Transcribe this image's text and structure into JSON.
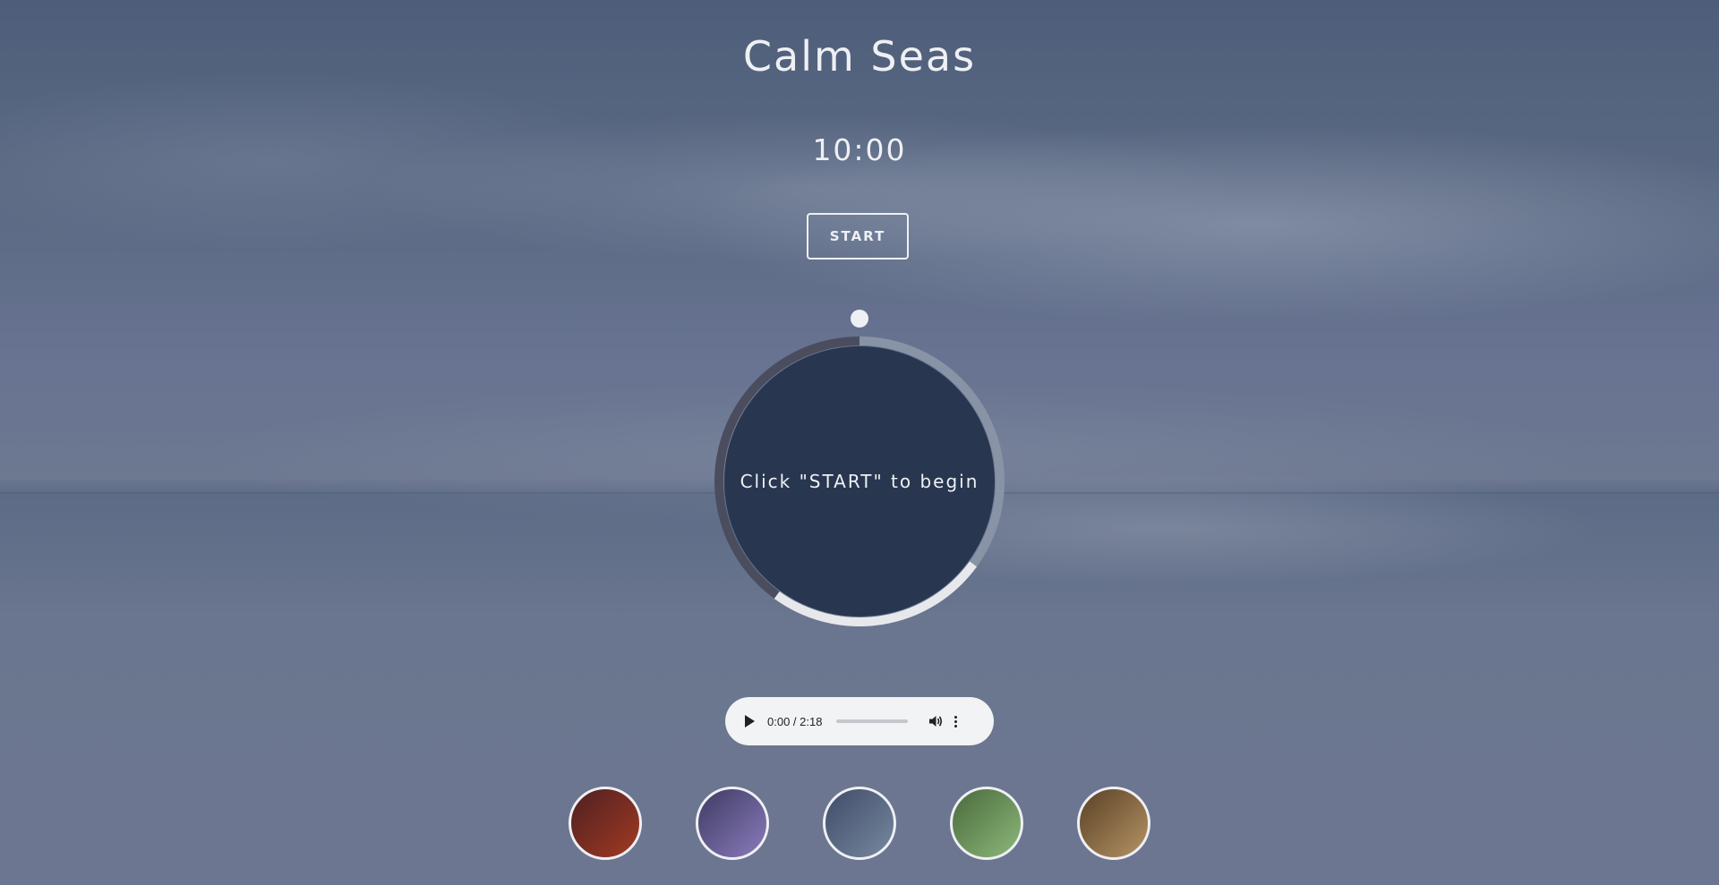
{
  "app": {
    "title": "Calm Seas"
  },
  "timer": {
    "display": "10:00",
    "start_label": "START"
  },
  "breath_circle": {
    "prompt": "Click \"START\" to begin",
    "colors": {
      "inner": "#283650",
      "track": "#8993a6",
      "dark_segment": "#4a4d5e",
      "light_segment": "#e6e8ec",
      "indicator": "#eef0f4"
    }
  },
  "audio_player": {
    "time": "0:00 / 2:18",
    "play_icon": "play-icon",
    "volume_icon": "volume-icon",
    "more_icon": "more-options-icon"
  },
  "themes": [
    {
      "name": "red-theme",
      "from": "#4e2022",
      "to": "#a23a22"
    },
    {
      "name": "purple-theme",
      "from": "#3e3b63",
      "to": "#8b7bbc"
    },
    {
      "name": "blue-theme",
      "from": "#3f4c68",
      "to": "#7888a0"
    },
    {
      "name": "green-theme",
      "from": "#4a6a3c",
      "to": "#8cb87a"
    },
    {
      "name": "brown-theme",
      "from": "#5a4126",
      "to": "#b59364"
    }
  ]
}
